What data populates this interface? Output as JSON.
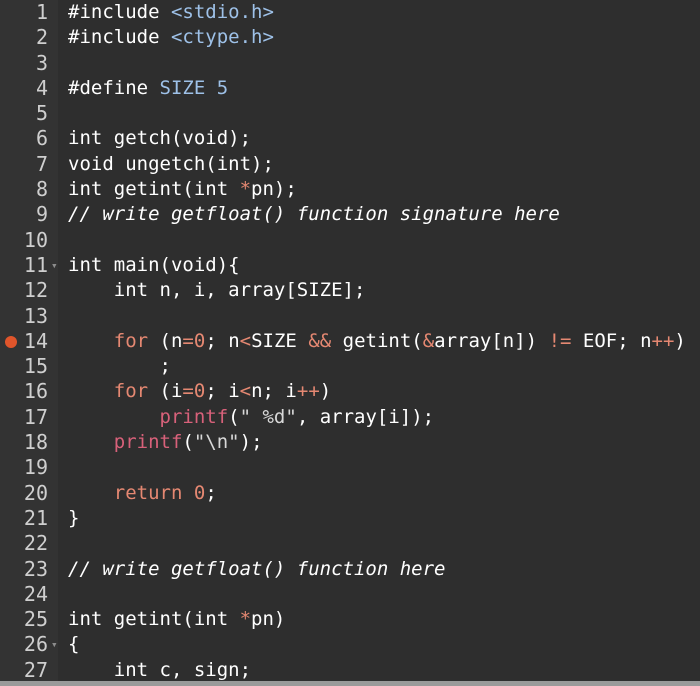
{
  "editor": {
    "breakpoint_line": "14",
    "lines": [
      {
        "n": "1",
        "tokens": [
          {
            "t": "#include ",
            "c": "text"
          },
          {
            "t": "<stdio.h>",
            "c": "preproc"
          }
        ]
      },
      {
        "n": "2",
        "tokens": [
          {
            "t": "#include ",
            "c": "text"
          },
          {
            "t": "<ctype.h>",
            "c": "preproc"
          }
        ]
      },
      {
        "n": "3",
        "tokens": []
      },
      {
        "n": "4",
        "tokens": [
          {
            "t": "#define ",
            "c": "text"
          },
          {
            "t": "SIZE 5",
            "c": "preproc"
          }
        ]
      },
      {
        "n": "5",
        "tokens": []
      },
      {
        "n": "6",
        "tokens": [
          {
            "t": "int getch(void);",
            "c": "text"
          }
        ]
      },
      {
        "n": "7",
        "tokens": [
          {
            "t": "void ungetch(int);",
            "c": "text"
          }
        ]
      },
      {
        "n": "8",
        "tokens": [
          {
            "t": "int getint(int ",
            "c": "text"
          },
          {
            "t": "*",
            "c": "operator"
          },
          {
            "t": "pn);",
            "c": "text"
          }
        ]
      },
      {
        "n": "9",
        "tokens": [
          {
            "t": "// write getfloat() function signature here",
            "c": "comment"
          }
        ]
      },
      {
        "n": "10",
        "tokens": []
      },
      {
        "n": "11",
        "fold": true,
        "tokens": [
          {
            "t": "int main(void){",
            "c": "text"
          }
        ]
      },
      {
        "n": "12",
        "tokens": [
          {
            "t": "    int n, i, array[SIZE];",
            "c": "text"
          }
        ]
      },
      {
        "n": "13",
        "tokens": []
      },
      {
        "n": "14",
        "tokens": [
          {
            "t": "    ",
            "c": "text"
          },
          {
            "t": "for",
            "c": "keyword"
          },
          {
            "t": " (n",
            "c": "text"
          },
          {
            "t": "=",
            "c": "operator"
          },
          {
            "t": "0",
            "c": "number"
          },
          {
            "t": "; n",
            "c": "text"
          },
          {
            "t": "<",
            "c": "operator"
          },
          {
            "t": "SIZE ",
            "c": "text"
          },
          {
            "t": "&&",
            "c": "operator"
          },
          {
            "t": " getint(",
            "c": "text"
          },
          {
            "t": "&",
            "c": "operator"
          },
          {
            "t": "array[n]) ",
            "c": "text"
          },
          {
            "t": "!=",
            "c": "operator"
          },
          {
            "t": " EOF; n",
            "c": "text"
          },
          {
            "t": "++",
            "c": "operator"
          },
          {
            "t": ")",
            "c": "text"
          }
        ]
      },
      {
        "n": "15",
        "tokens": [
          {
            "t": "        ;",
            "c": "text"
          }
        ]
      },
      {
        "n": "16",
        "tokens": [
          {
            "t": "    ",
            "c": "text"
          },
          {
            "t": "for",
            "c": "keyword"
          },
          {
            "t": " (i",
            "c": "text"
          },
          {
            "t": "=",
            "c": "operator"
          },
          {
            "t": "0",
            "c": "number"
          },
          {
            "t": "; i",
            "c": "text"
          },
          {
            "t": "<",
            "c": "operator"
          },
          {
            "t": "n; i",
            "c": "text"
          },
          {
            "t": "++",
            "c": "operator"
          },
          {
            "t": ")",
            "c": "text"
          }
        ]
      },
      {
        "n": "17",
        "tokens": [
          {
            "t": "        ",
            "c": "text"
          },
          {
            "t": "printf",
            "c": "func"
          },
          {
            "t": "(",
            "c": "text"
          },
          {
            "t": "\" %d\"",
            "c": "string"
          },
          {
            "t": ", array[i]);",
            "c": "text"
          }
        ]
      },
      {
        "n": "18",
        "tokens": [
          {
            "t": "    ",
            "c": "text"
          },
          {
            "t": "printf",
            "c": "func"
          },
          {
            "t": "(",
            "c": "text"
          },
          {
            "t": "\"\\n\"",
            "c": "string"
          },
          {
            "t": ");",
            "c": "text"
          }
        ]
      },
      {
        "n": "19",
        "tokens": []
      },
      {
        "n": "20",
        "tokens": [
          {
            "t": "    ",
            "c": "text"
          },
          {
            "t": "return",
            "c": "keyword"
          },
          {
            "t": " ",
            "c": "text"
          },
          {
            "t": "0",
            "c": "number"
          },
          {
            "t": ";",
            "c": "text"
          }
        ]
      },
      {
        "n": "21",
        "tokens": [
          {
            "t": "}",
            "c": "text"
          }
        ]
      },
      {
        "n": "22",
        "tokens": []
      },
      {
        "n": "23",
        "tokens": [
          {
            "t": "// write getfloat() function here",
            "c": "comment"
          }
        ]
      },
      {
        "n": "24",
        "tokens": []
      },
      {
        "n": "25",
        "tokens": [
          {
            "t": "int getint(int ",
            "c": "text"
          },
          {
            "t": "*",
            "c": "operator"
          },
          {
            "t": "pn)",
            "c": "text"
          }
        ]
      },
      {
        "n": "26",
        "fold": true,
        "tokens": [
          {
            "t": "{",
            "c": "text"
          }
        ]
      },
      {
        "n": "27",
        "tokens": [
          {
            "t": "    int c, sign;",
            "c": "text"
          }
        ]
      }
    ]
  }
}
